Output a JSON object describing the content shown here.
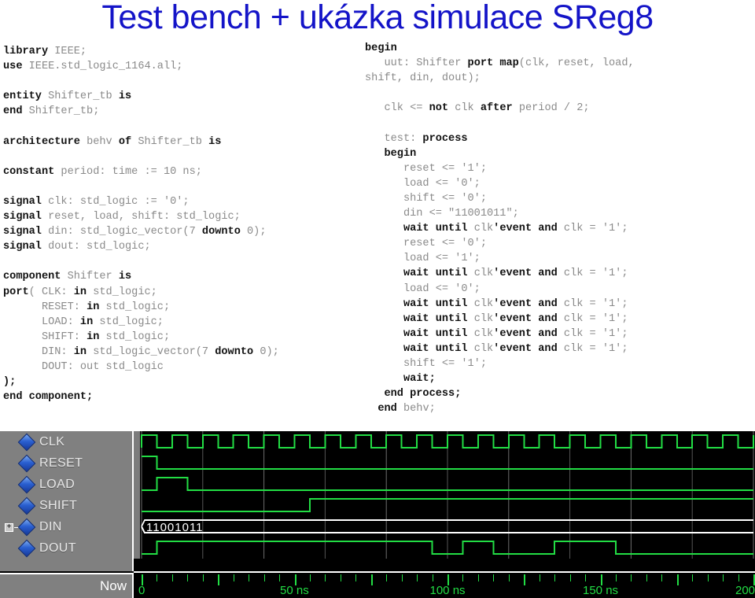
{
  "title": "Test bench + ukázka simulace SReg8",
  "title_color": "#1414c8",
  "code_left": [
    [
      [
        "library",
        "k"
      ],
      [
        " IEEE;",
        "i"
      ]
    ],
    [
      [
        "use",
        "k"
      ],
      [
        " IEEE.std_logic_1164.all;",
        "i"
      ]
    ],
    [],
    [
      [
        "entity",
        "k"
      ],
      [
        " Shifter_tb ",
        "i"
      ],
      [
        "is",
        "k"
      ]
    ],
    [
      [
        "end",
        "k"
      ],
      [
        " Shifter_tb;",
        "i"
      ]
    ],
    [],
    [
      [
        "architecture",
        "k"
      ],
      [
        " behv ",
        "i"
      ],
      [
        "of",
        "k"
      ],
      [
        " Shifter_tb ",
        "i"
      ],
      [
        "is",
        "k"
      ]
    ],
    [],
    [
      [
        "constant",
        "k"
      ],
      [
        " period: time := 10 ns;",
        "i"
      ]
    ],
    [],
    [
      [
        "signal",
        "k"
      ],
      [
        " clk: std_logic := '0';",
        "i"
      ]
    ],
    [
      [
        "signal",
        "k"
      ],
      [
        " reset, load, shift: std_logic;",
        "i"
      ]
    ],
    [
      [
        "signal",
        "k"
      ],
      [
        " din: std_logic_vector(7 ",
        "i"
      ],
      [
        "downto",
        "k"
      ],
      [
        " 0);",
        "i"
      ]
    ],
    [
      [
        "signal",
        "k"
      ],
      [
        " dout: std_logic;",
        "i"
      ]
    ],
    [],
    [
      [
        "component",
        "k"
      ],
      [
        " Shifter ",
        "i"
      ],
      [
        "is",
        "k"
      ]
    ],
    [
      [
        "port",
        "k"
      ],
      [
        "( CLK: ",
        "i"
      ],
      [
        "in",
        "k"
      ],
      [
        " std_logic;",
        "i"
      ]
    ],
    [
      [
        "      RESET: ",
        "i"
      ],
      [
        "in",
        "k"
      ],
      [
        " std_logic;",
        "i"
      ]
    ],
    [
      [
        "      LOAD: ",
        "i"
      ],
      [
        "in",
        "k"
      ],
      [
        " std_logic;",
        "i"
      ]
    ],
    [
      [
        "      SHIFT: ",
        "i"
      ],
      [
        "in",
        "k"
      ],
      [
        " std_logic;",
        "i"
      ]
    ],
    [
      [
        "      DIN: ",
        "i"
      ],
      [
        "in",
        "k"
      ],
      [
        " std_logic_vector(7 ",
        "i"
      ],
      [
        "downto",
        "k"
      ],
      [
        " 0);",
        "i"
      ]
    ],
    [
      [
        "      DOUT: out std_logic",
        "i"
      ]
    ],
    [
      [
        ");",
        "k"
      ]
    ],
    [
      [
        "end component;",
        "k"
      ]
    ]
  ],
  "code_right": [
    [
      [
        "begin",
        "k"
      ]
    ],
    [
      [
        "   uut: Shifter ",
        "i"
      ],
      [
        "port map",
        "k"
      ],
      [
        "(clk, reset, load,",
        "i"
      ]
    ],
    [
      [
        "shift, din, dout);",
        "i"
      ]
    ],
    [],
    [
      [
        "   clk <= ",
        "i"
      ],
      [
        "not",
        "k"
      ],
      [
        " clk ",
        "i"
      ],
      [
        "after",
        "k"
      ],
      [
        " period / 2;",
        "i"
      ]
    ],
    [],
    [
      [
        "   test: ",
        "i"
      ],
      [
        "process",
        "k"
      ]
    ],
    [
      [
        "   ",
        "i"
      ],
      [
        "begin",
        "k"
      ]
    ],
    [
      [
        "      reset <= '1';",
        "i"
      ]
    ],
    [
      [
        "      load <= '0';",
        "i"
      ]
    ],
    [
      [
        "      shift <= '0';",
        "i"
      ]
    ],
    [
      [
        "      din <= \"11001011\";",
        "i"
      ]
    ],
    [
      [
        "      ",
        "i"
      ],
      [
        "wait until",
        "k"
      ],
      [
        " clk",
        "i"
      ],
      [
        "'event and",
        "k"
      ],
      [
        " clk = '1';",
        "i"
      ]
    ],
    [
      [
        "      reset <= '0';",
        "i"
      ]
    ],
    [
      [
        "      load <= '1';",
        "i"
      ]
    ],
    [
      [
        "      ",
        "i"
      ],
      [
        "wait until",
        "k"
      ],
      [
        " clk",
        "i"
      ],
      [
        "'event and",
        "k"
      ],
      [
        " clk = '1';",
        "i"
      ]
    ],
    [
      [
        "      load <= '0';",
        "i"
      ]
    ],
    [
      [
        "      ",
        "i"
      ],
      [
        "wait until",
        "k"
      ],
      [
        " clk",
        "i"
      ],
      [
        "'event and",
        "k"
      ],
      [
        " clk = '1';",
        "i"
      ]
    ],
    [
      [
        "      ",
        "i"
      ],
      [
        "wait until",
        "k"
      ],
      [
        " clk",
        "i"
      ],
      [
        "'event and",
        "k"
      ],
      [
        " clk = '1';",
        "i"
      ]
    ],
    [
      [
        "      ",
        "i"
      ],
      [
        "wait until",
        "k"
      ],
      [
        " clk",
        "i"
      ],
      [
        "'event and",
        "k"
      ],
      [
        " clk = '1';",
        "i"
      ]
    ],
    [
      [
        "      ",
        "i"
      ],
      [
        "wait until",
        "k"
      ],
      [
        " clk",
        "i"
      ],
      [
        "'event and",
        "k"
      ],
      [
        " clk = '1';",
        "i"
      ]
    ],
    [
      [
        "      shift <= '1';",
        "i"
      ]
    ],
    [
      [
        "      ",
        "i"
      ],
      [
        "wait;",
        "k"
      ]
    ],
    [
      [
        "   ",
        "i"
      ],
      [
        "end process;",
        "k"
      ]
    ],
    [
      [
        "  ",
        "i"
      ],
      [
        "end",
        "k"
      ],
      [
        " behv;",
        "i"
      ]
    ]
  ],
  "waveform": {
    "now_label": "Now",
    "signals": [
      {
        "name": "CLK",
        "icon": "signal-diamond-icon",
        "expandable": false
      },
      {
        "name": "RESET",
        "icon": "signal-diamond-icon",
        "expandable": false
      },
      {
        "name": "LOAD",
        "icon": "signal-diamond-icon",
        "expandable": false
      },
      {
        "name": "SHIFT",
        "icon": "signal-diamond-icon",
        "expandable": false
      },
      {
        "name": "DIN",
        "icon": "signal-diamond-icon",
        "expandable": true,
        "expander": "+"
      },
      {
        "name": "DOUT",
        "icon": "signal-diamond-icon",
        "expandable": false
      }
    ],
    "bus_value": "11001011",
    "time_labels": [
      "0",
      "50 ns",
      "100 ns",
      "150 ns",
      "200"
    ],
    "time_label_ns": [
      0,
      50,
      100,
      150,
      200
    ],
    "time_range_ns": [
      0,
      200
    ],
    "clock_period_ns": 10,
    "minor_tick_ns": 5,
    "major_tick_ns": 25,
    "wave_color": "#22dd44",
    "bus_color": "#ffffff",
    "panel_color": "#808080",
    "background_color": "#000000",
    "traces": {
      "CLK": {
        "type": "clock",
        "period_ns": 10,
        "start_low": true
      },
      "RESET": {
        "type": "digital",
        "transitions": [
          [
            0,
            1
          ],
          [
            5,
            0
          ]
        ]
      },
      "LOAD": {
        "type": "digital",
        "transitions": [
          [
            0,
            0
          ],
          [
            5,
            1
          ],
          [
            15,
            0
          ]
        ]
      },
      "SHIFT": {
        "type": "digital",
        "transitions": [
          [
            0,
            0
          ],
          [
            55,
            1
          ]
        ]
      },
      "DIN": {
        "type": "bus",
        "value": "11001011",
        "start_ns": 0
      },
      "DOUT": {
        "type": "digital",
        "transitions": [
          [
            0,
            0
          ],
          [
            5,
            1
          ],
          [
            95,
            0
          ],
          [
            105,
            1
          ],
          [
            115,
            0
          ],
          [
            135,
            1
          ],
          [
            155,
            0
          ]
        ]
      }
    }
  }
}
